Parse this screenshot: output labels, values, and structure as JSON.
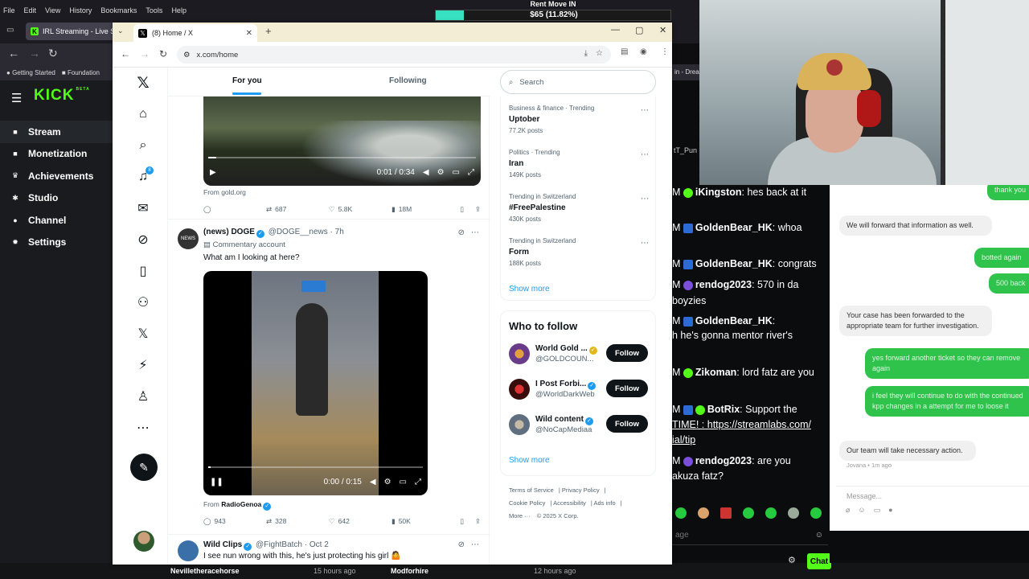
{
  "outer_browser": {
    "menu": [
      "File",
      "Edit",
      "View",
      "History",
      "Bookmarks",
      "Tools",
      "Help"
    ],
    "tab_title": "IRL Streaming - Live Stre",
    "bookmarks": [
      "Getting Started",
      "Foundation"
    ],
    "right_tab_fragment": "in - Drea"
  },
  "kick": {
    "logo": "KICK",
    "logo_badge": "BETA",
    "nav": [
      {
        "label": "Stream",
        "icon": "stream-icon"
      },
      {
        "label": "Monetization",
        "icon": "monetization-icon"
      },
      {
        "label": "Achievements",
        "icon": "trophy-icon"
      },
      {
        "label": "Studio",
        "icon": "studio-icon"
      },
      {
        "label": "Channel",
        "icon": "channel-icon"
      },
      {
        "label": "Settings",
        "icon": "gear-icon"
      }
    ],
    "bottom_bar": [
      {
        "name": "Nevilletheracehorse",
        "time": "15 hours ago"
      },
      {
        "name": "Modforhire",
        "time": "12 hours ago"
      }
    ]
  },
  "overlay": {
    "title": "Rent Move IN",
    "value": "$65 (11.82%)",
    "progress": 0.1182
  },
  "chrome": {
    "tab_title": "(8) Home / X",
    "url": "x.com/home"
  },
  "x": {
    "tabs": {
      "for_you": "For you",
      "following": "Following"
    },
    "search_placeholder": "Search",
    "notification_count": "8",
    "post1": {
      "time": "0:01 / 0:34",
      "source": "From gold.org",
      "retweets": "687",
      "likes": "5.8K",
      "views": "18M"
    },
    "post2": {
      "avatar_text": "NEWS",
      "name": "(news) DOGE",
      "handle": "@DOGE__news",
      "time": "7h",
      "label": "Commentary account",
      "text": "What am I looking at here?",
      "video_time": "0:00 / 0:15",
      "source_prefix": "From",
      "source_name": "RadioGenoa",
      "replies": "943",
      "retweets": "328",
      "likes": "642",
      "views": "50K"
    },
    "post3": {
      "name": "Wild Clips",
      "handle": "@FightBatch",
      "time": "Oct 2",
      "text": "I see nun wrong with this, he's just protecting his girl 🤷"
    },
    "trends": [
      {
        "category": "Business & finance · Trending",
        "name": "Uptober",
        "count": "77.2K posts"
      },
      {
        "category": "Politics · Trending",
        "name": "Iran",
        "count": "149K posts"
      },
      {
        "category": "Trending in Switzerland",
        "name": "#FreePalestine",
        "count": "430K posts"
      },
      {
        "category": "Trending in Switzerland",
        "name": "Form",
        "count": "188K posts"
      }
    ],
    "show_more": "Show more",
    "who_to_follow": "Who to follow",
    "follow_suggestions": [
      {
        "name": "World Gold ...",
        "handle": "@GOLDCOUN...",
        "avatar_color": "#6b3b8b",
        "verified": "gold"
      },
      {
        "name": "I Post Forbi...",
        "handle": "@WorldDarkWeb",
        "avatar_color": "#8b1a1a",
        "verified": "blue"
      },
      {
        "name": "Wild content",
        "handle": "@NoCapMediaa",
        "avatar_color": "#5f6f7f",
        "verified": "blue"
      }
    ],
    "follow_label": "Follow",
    "footer": {
      "terms": "Terms of Service",
      "privacy": "Privacy Policy",
      "cookie": "Cookie Policy",
      "accessibility": "Accessibility",
      "ads": "Ads info",
      "more": "More ···",
      "copyright": "© 2025 X Corp."
    }
  },
  "chat": {
    "messages": [
      {
        "user": "iKingston",
        "text": ": hes back at it",
        "badge": "green"
      },
      {
        "user": "GoldenBear_HK",
        "text": ": whoa",
        "badge": "blue"
      },
      {
        "user": "GoldenBear_HK",
        "text": ": congrats",
        "badge": "blue"
      },
      {
        "user": "rendog2023",
        "text": ": 570 in da boyzies",
        "badge": "purple"
      },
      {
        "user": "GoldenBear_HK",
        "text": ":",
        "badge": "blue"
      },
      {
        "user": "",
        "text": "h he's gonna mentor river's",
        "badge": ""
      },
      {
        "user": "Zikoman",
        "text": ": lord fatz are you",
        "badge": "green"
      },
      {
        "user": "BotRix",
        "text": ": Support the",
        "badge": "blue"
      },
      {
        "user": "",
        "text": "TIME! : https://streamlabs.com/",
        "badge": ""
      },
      {
        "user": "",
        "text": "ial/tip",
        "badge": ""
      },
      {
        "user": "rendog2023",
        "text": ": are you",
        "badge": "purple"
      },
      {
        "user": "",
        "text": "akuza fatz?",
        "badge": ""
      }
    ],
    "input_placeholder": "age",
    "chat_button": "Chat",
    "partial_user": "tT_Pun"
  },
  "support": {
    "bubbles": [
      {
        "dir": "out",
        "text": "thank you"
      },
      {
        "dir": "in",
        "text": "We will forward that information as well."
      },
      {
        "dir": "out",
        "text": "botted again"
      },
      {
        "dir": "out",
        "text": "500 back"
      },
      {
        "dir": "in",
        "text": "Your case has been forwarded to the appropriate team for further investigation."
      },
      {
        "dir": "out",
        "text": "yes forward another ticket so they can remove again"
      },
      {
        "dir": "out",
        "text": "i feel they will continue to do with the continued kpp changes in a attempt for me to loose it"
      },
      {
        "dir": "in",
        "text": "Our team will take necessary action."
      }
    ],
    "meta": "Jovana • 1m ago",
    "input_placeholder": "Message..."
  }
}
